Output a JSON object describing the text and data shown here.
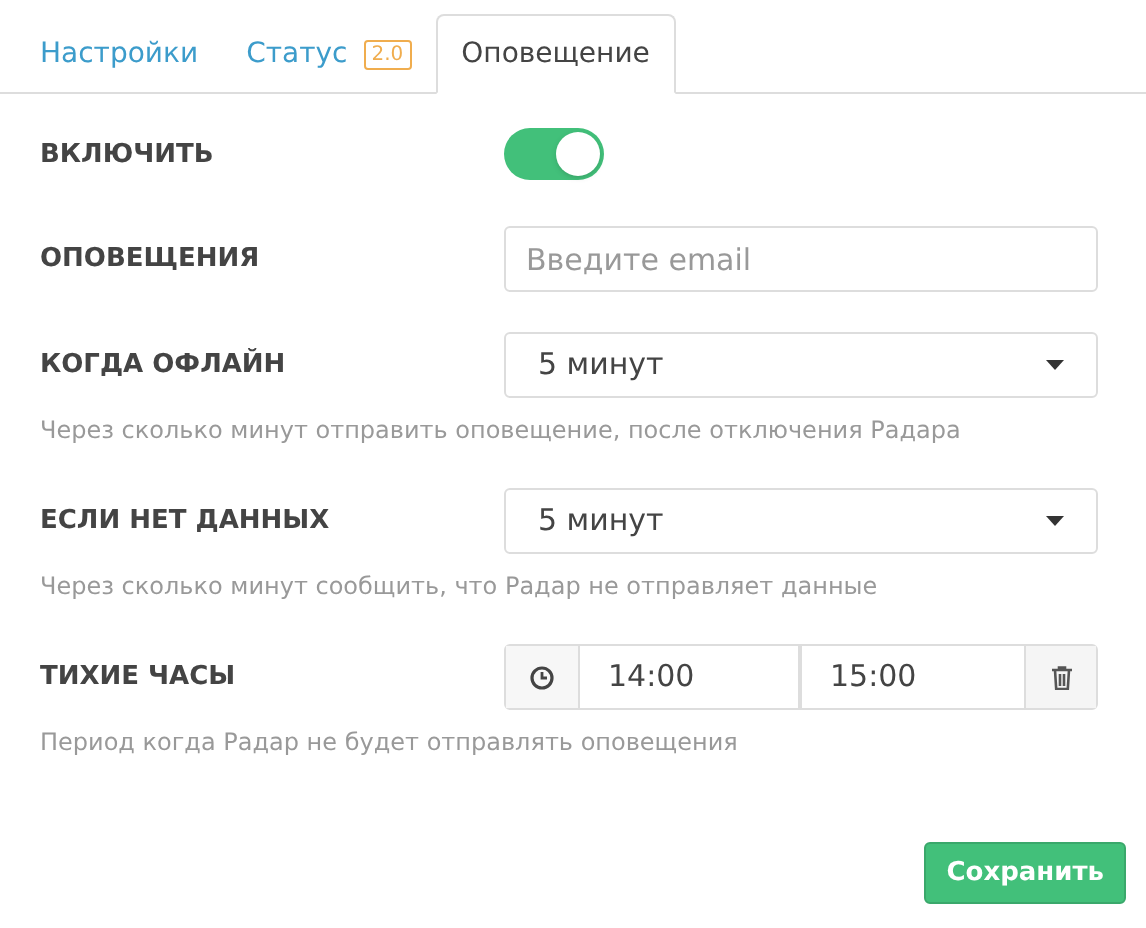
{
  "tabs": [
    {
      "label": "Настройки",
      "selected": false
    },
    {
      "label": "Статус",
      "badge": "2.0",
      "selected": false
    },
    {
      "label": "Оповещение",
      "selected": true
    }
  ],
  "fields": [
    {
      "kind": "toggle",
      "label": "ВКЛЮЧИТЬ",
      "on": true
    },
    {
      "kind": "text",
      "label": "ОПОВЕЩЕНИЯ",
      "placeholder": "Введите email"
    },
    {
      "kind": "select",
      "label": "КОГДА ОФЛАЙН",
      "value": "5 минут",
      "help": "Через сколько минут отправить оповещение, после отключения Радара"
    },
    {
      "kind": "select",
      "label": "ЕСЛИ НЕТ ДАННЫХ",
      "value": "5 минут",
      "help": "Через сколько минут сообщить, что Радар не отправляет данные"
    },
    {
      "kind": "timerange",
      "label": "ТИХИЕ ЧАСЫ",
      "from": "14:00",
      "to": "15:00",
      "help": "Период когда Радар не будет отправлять оповещения"
    }
  ],
  "save_button": "Сохранить"
}
